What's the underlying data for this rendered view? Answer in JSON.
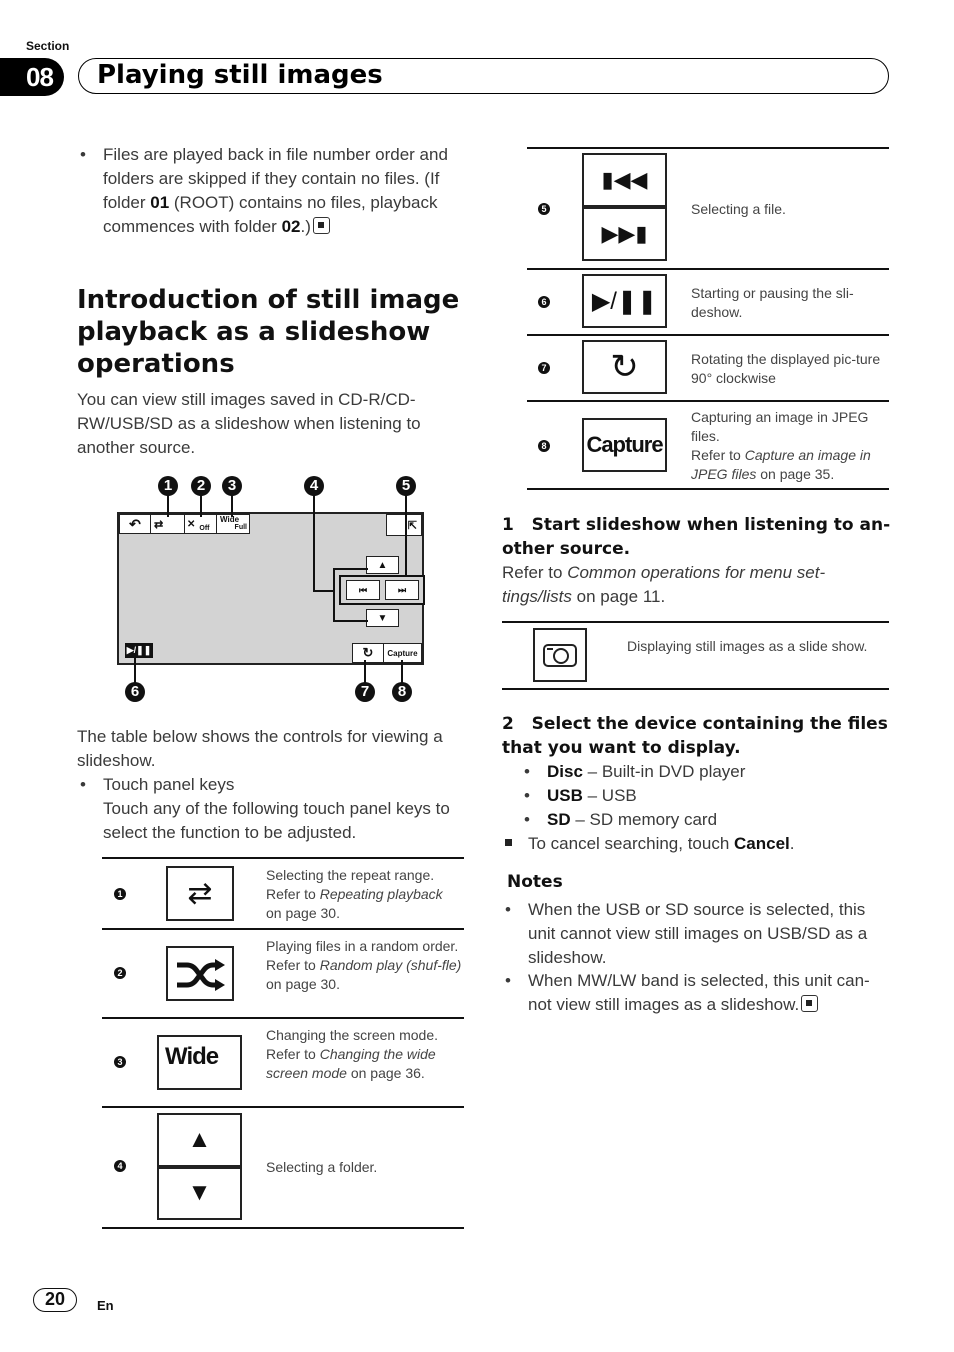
{
  "header": {
    "section_label": "Section",
    "section_number": "08",
    "title": "Playing still images"
  },
  "intro_bullet": {
    "prefix": "Files are played back in file number order and folders are skipped if they contain no files. (If folder ",
    "bold1": "01",
    "middle": " (ROOT) contains no files, playback commences with folder ",
    "bold2": "02",
    "suffix": ".)"
  },
  "section": {
    "heading": "Introduction of still image playback as a slideshow operations",
    "paragraph": "You can view still images saved in CD-R/CD-RW/USB/SD as a slideshow when listening to another source."
  },
  "screen": {
    "callouts": [
      "1",
      "2",
      "3",
      "4",
      "5",
      "6",
      "7",
      "8"
    ],
    "random_state": "Off",
    "wide_label": "Wide",
    "wide_state": "Full",
    "capture_label": "Capture"
  },
  "table_intro": {
    "text": "The table below shows the controls for viewing a slideshow.",
    "bullet_title": "Touch panel keys",
    "bullet_text": "Touch any of the following touch panel keys to select the function to be adjusted."
  },
  "left_table": [
    {
      "num": "1",
      "icon": "repeat-icon",
      "desc": "Selecting the repeat range.",
      "ref_prefix": "Refer to ",
      "ref": "Repeating playback",
      "ref_suffix": " on page 30."
    },
    {
      "num": "2",
      "icon": "shuffle-icon",
      "desc": "Playing files in a random order.",
      "ref_prefix": "Refer to ",
      "ref": "Random play (shuf-fle)",
      "ref_suffix": " on page 30."
    },
    {
      "num": "3",
      "icon": "wide-label",
      "key_label": "Wide",
      "desc": "Changing the screen mode.",
      "ref_prefix": "Refer to ",
      "ref": "Changing the wide screen mode",
      "ref_suffix": " on page 36."
    },
    {
      "num": "4",
      "icon": "folder-up-down-icon",
      "desc": "Selecting a folder."
    }
  ],
  "right_table": [
    {
      "num": "5",
      "icon": "prev-next-icon",
      "desc": "Selecting a file."
    },
    {
      "num": "6",
      "icon": "play-pause-icon",
      "desc": "Starting or pausing the sli-deshow."
    },
    {
      "num": "7",
      "icon": "rotate-icon",
      "desc": "Rotating the displayed pic-ture 90° clockwise"
    },
    {
      "num": "8",
      "icon": "capture-label",
      "key_label": "Capture",
      "desc": "Capturing an image in JPEG files.",
      "ref_prefix": "Refer to ",
      "ref": "Capture an image in JPEG files",
      "ref_suffix": " on page 35."
    }
  ],
  "step1": {
    "number": "1",
    "heading": "Start slideshow when listening to an-other source.",
    "ref_prefix": "Refer to ",
    "ref": "Common operations for menu set-tings/lists",
    "ref_suffix": " on page 11.",
    "key_desc": "Displaying still images as a slide show."
  },
  "step2": {
    "number": "2",
    "heading": "Select the device containing the files that you want to display.",
    "options": [
      {
        "label": "Disc",
        "desc": " – Built-in DVD player"
      },
      {
        "label": "USB",
        "desc": " – USB"
      },
      {
        "label": "SD",
        "desc": " – SD memory card"
      }
    ],
    "cancel_prefix": "To cancel searching, touch ",
    "cancel_label": "Cancel",
    "cancel_suffix": "."
  },
  "notes": {
    "title": "Notes",
    "items": [
      "When the USB or SD source is selected, this unit cannot view still images on USB/SD as a slideshow.",
      "When MW/LW band is selected, this unit can-not view still images as a slideshow."
    ]
  },
  "footer": {
    "page_number": "20",
    "language": "En"
  }
}
